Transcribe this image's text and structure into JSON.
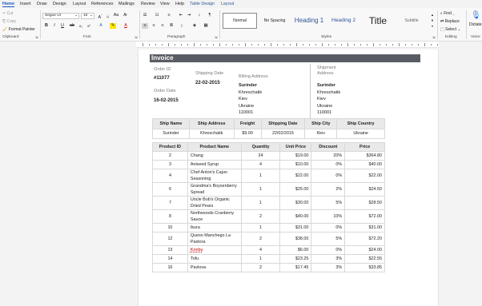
{
  "tabs": [
    "Home",
    "Insert",
    "Draw",
    "Design",
    "Layout",
    "References",
    "Mailings",
    "Review",
    "View",
    "Help",
    "Table Design",
    "Layout"
  ],
  "ribbon": {
    "clipboard": {
      "cut": "Cut",
      "copy": "Copy",
      "format_painter": "Format Painter",
      "label": "Clipboard"
    },
    "font": {
      "name": "Segoe UI",
      "size": "10",
      "label": "Font"
    },
    "paragraph": {
      "label": "Paragraph"
    },
    "styles": {
      "items": [
        "Normal",
        "No Spacing",
        "Heading 1",
        "Heading 2",
        "Title",
        "Subtitle"
      ],
      "label": "Styles"
    },
    "editing": {
      "find": "Find",
      "replace": "Replace",
      "select": "Select",
      "label": "Editing"
    },
    "voice": {
      "dictate": "Dictate",
      "label": "Voice"
    }
  },
  "doc": {
    "title": "Invoice",
    "order_id_label": "Order ID",
    "order_id": "#11077",
    "shipping_date_label": "Shipping Date",
    "shipping_date": "22-02-2015",
    "order_date_label": "Order Date",
    "order_date": "16-02-2015",
    "billing_label": "Billing Address",
    "billing": [
      "Surinder",
      "Khreschatik",
      "Kiev",
      "Ukraine",
      "110001"
    ],
    "shipment_label": "Shipment Address",
    "shipment": [
      "Surinder",
      "Khreschatik",
      "Kiev",
      "Ukraine",
      "110001"
    ],
    "ship_table": {
      "headers": [
        "Ship Name",
        "Ship Address",
        "Freight",
        "Shipping Date",
        "Ship City",
        "Ship Country"
      ],
      "row": [
        "Surinder",
        "Khreschatik",
        "$9.00",
        "22/02/2015",
        "Kiev",
        "Ukraine"
      ]
    },
    "products": {
      "headers": [
        "Product ID",
        "Product Name",
        "Quantity",
        "Unit Price",
        "Discount",
        "Price"
      ],
      "rows": [
        [
          "2",
          "Chang",
          "24",
          "$19.00",
          "20%",
          "$364.80"
        ],
        [
          "3",
          "Aniseed Syrup",
          "4",
          "$10.00",
          "0%",
          "$40.00"
        ],
        [
          "4",
          "Chef Anton's Cajun Seasoning",
          "1",
          "$22.00",
          "0%",
          "$22.00"
        ],
        [
          "6",
          "Grandma's Boysenberry Spread",
          "1",
          "$25.00",
          "2%",
          "$24.50"
        ],
        [
          "7",
          "Uncle Bob's Organic Dried Pears",
          "1",
          "$30.00",
          "5%",
          "$28.50"
        ],
        [
          "8",
          "Northwoods Cranberry Sauce",
          "2",
          "$40.00",
          "10%",
          "$72.00"
        ],
        [
          "10",
          "Ikura",
          "1",
          "$31.00",
          "0%",
          "$31.00"
        ],
        [
          "12",
          "Queso Manchego La Pastora",
          "2",
          "$38.00",
          "5%",
          "$72.20"
        ],
        [
          "13",
          "Konbu",
          "4",
          "$6.00",
          "0%",
          "$24.00"
        ],
        [
          "14",
          "Tofu",
          "1",
          "$23.25",
          "3%",
          "$22.55"
        ],
        [
          "16",
          "Pavlova",
          "2",
          "$17.45",
          "3%",
          "$33.85"
        ]
      ]
    }
  }
}
